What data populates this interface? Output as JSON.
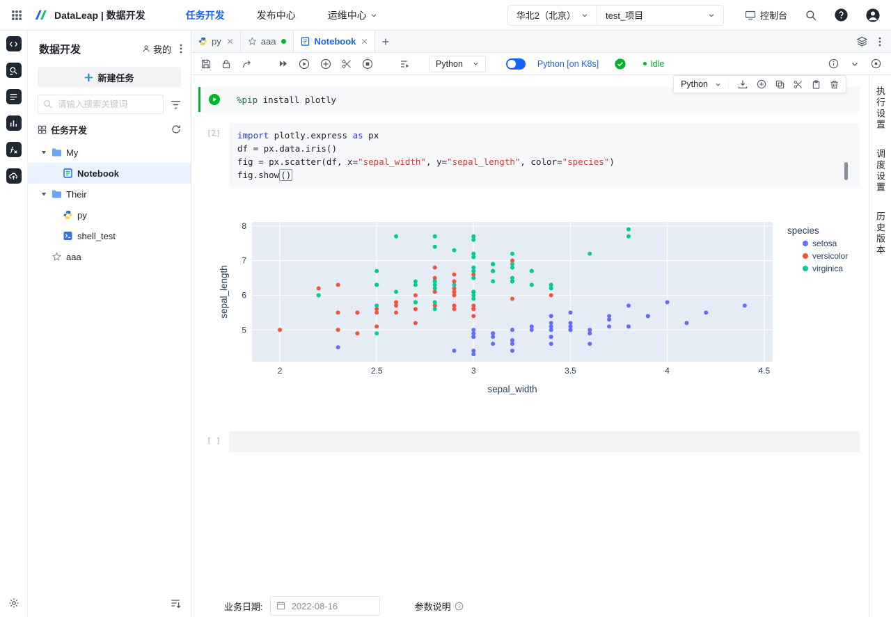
{
  "header": {
    "brand": "DataLeap | 数据开发",
    "nav": [
      {
        "label": "任务开发",
        "active": true,
        "caret": false
      },
      {
        "label": "发布中心",
        "active": false,
        "caret": false
      },
      {
        "label": "运维中心",
        "active": false,
        "caret": true
      }
    ],
    "region_select": "华北2（北京）",
    "project_select": "test_项目",
    "console_label": "控制台"
  },
  "sidebar": {
    "title": "数据开发",
    "mine_label": "我的",
    "new_task_label": "新建任务",
    "search_placeholder": "请输入搜索关键词",
    "section_label": "任务开发",
    "tree": [
      {
        "label": "My",
        "type": "folder",
        "depth": 0,
        "expanded": true,
        "selected": false
      },
      {
        "label": "Notebook",
        "type": "notebook",
        "depth": 1,
        "selected": true
      },
      {
        "label": "Their",
        "type": "folder",
        "depth": 0,
        "expanded": true,
        "selected": false
      },
      {
        "label": "py",
        "type": "python",
        "depth": 1,
        "selected": false
      },
      {
        "label": "shell_test",
        "type": "shell",
        "depth": 1,
        "selected": false
      },
      {
        "label": "aaa",
        "type": "star",
        "depth": 0,
        "selected": false
      }
    ]
  },
  "tabs": [
    {
      "label": "py",
      "icon": "python",
      "closable": true,
      "dot": false,
      "active": false
    },
    {
      "label": "aaa",
      "icon": "star",
      "closable": false,
      "dot": true,
      "active": false
    },
    {
      "label": "Notebook",
      "icon": "notebook",
      "closable": true,
      "dot": false,
      "active": true
    }
  ],
  "toolbar": {
    "kernel_select": "Python",
    "k8s_toggle_label": "Python [on K8s]",
    "status_label": "Idle"
  },
  "cell_toolbar": {
    "kernel_select": "Python"
  },
  "notebook": {
    "cells": [
      {
        "kind": "magic",
        "tokens": [
          [
            {
              "t": "magic",
              "s": "%pip"
            },
            {
              "t": "p",
              "s": " install plotly"
            }
          ]
        ]
      },
      {
        "kind": "code",
        "exec": "[2]",
        "output": "chart",
        "tokens": [
          [
            {
              "t": "kw",
              "s": "import"
            },
            {
              "t": "p",
              "s": " plotly.express "
            },
            {
              "t": "kw",
              "s": "as"
            },
            {
              "t": "p",
              "s": " px"
            }
          ],
          [
            {
              "t": "p",
              "s": "df = px.data.iris()"
            }
          ],
          [
            {
              "t": "p",
              "s": "fig = px.scatter(df, x="
            },
            {
              "t": "str",
              "s": "\"sepal_width\""
            },
            {
              "t": "p",
              "s": ", y="
            },
            {
              "t": "str",
              "s": "\"sepal_length\""
            },
            {
              "t": "p",
              "s": ", color="
            },
            {
              "t": "str",
              "s": "\"species\""
            },
            {
              "t": "p",
              "s": ")"
            }
          ],
          [
            {
              "t": "p",
              "s": "fig.show"
            },
            {
              "t": "box",
              "s": "()"
            }
          ]
        ]
      },
      {
        "kind": "empty",
        "exec": "[ ]"
      }
    ]
  },
  "right_panel": {
    "labels": [
      "执行设置",
      "调度设置",
      "历史版本"
    ]
  },
  "bottom_bar": {
    "date_label": "业务日期:",
    "date_value": "2022-08-16",
    "param_label": "参数说明"
  },
  "icons": {
    "help_glyph": "?",
    "accent_blue": "#1664ff",
    "success_green": "#00b42a"
  },
  "chart_data": {
    "type": "scatter",
    "title": "",
    "xlabel": "sepal_width",
    "ylabel": "sepal_length",
    "xlim": [
      1.856,
      4.544
    ],
    "ylim": [
      4.084,
      8.116
    ],
    "xticks": [
      2,
      2.5,
      3,
      3.5,
      4,
      4.5
    ],
    "yticks": [
      5,
      6,
      7,
      8
    ],
    "grid": true,
    "plot_bg": "#e5ecf6",
    "legend_title": "species",
    "legend_position": "right",
    "series": [
      {
        "name": "setosa",
        "color": "#636efa",
        "x": [
          3.5,
          3.0,
          3.2,
          3.1,
          3.6,
          3.9,
          3.4,
          3.4,
          2.9,
          3.1,
          3.7,
          3.4,
          3.0,
          3.0,
          4.0,
          4.4,
          3.9,
          3.5,
          3.8,
          3.8,
          3.4,
          3.7,
          3.6,
          3.3,
          3.4,
          3.0,
          3.4,
          3.5,
          3.4,
          3.2,
          3.1,
          3.4,
          4.1,
          4.2,
          3.1,
          3.2,
          3.5,
          3.6,
          3.0,
          3.4,
          3.5,
          2.3,
          3.2,
          3.5,
          3.8,
          3.0,
          3.8,
          3.2,
          3.7,
          3.3
        ],
        "y": [
          5.1,
          4.9,
          4.7,
          4.6,
          5.0,
          5.4,
          4.6,
          5.0,
          4.4,
          4.9,
          5.4,
          4.8,
          4.8,
          4.3,
          5.8,
          5.7,
          5.4,
          5.1,
          5.7,
          5.1,
          5.4,
          5.1,
          4.6,
          5.1,
          4.8,
          5.0,
          5.0,
          5.2,
          5.2,
          4.7,
          4.8,
          5.4,
          5.2,
          5.5,
          4.9,
          5.0,
          5.5,
          4.9,
          4.4,
          5.1,
          5.0,
          4.5,
          4.4,
          5.0,
          5.1,
          4.8,
          5.1,
          4.6,
          5.3,
          5.0
        ]
      },
      {
        "name": "versicolor",
        "color": "#EF553B",
        "x": [
          3.2,
          3.2,
          3.1,
          2.3,
          2.8,
          2.8,
          3.3,
          2.4,
          2.9,
          2.7,
          2.0,
          3.0,
          2.2,
          2.9,
          2.9,
          3.1,
          3.0,
          2.7,
          2.2,
          2.5,
          3.2,
          2.8,
          2.5,
          2.8,
          2.9,
          3.0,
          2.8,
          3.0,
          2.9,
          2.6,
          2.4,
          2.4,
          2.7,
          2.7,
          3.0,
          3.4,
          3.1,
          2.3,
          3.0,
          2.5,
          2.6,
          3.0,
          2.6,
          2.3,
          2.7,
          3.0,
          2.9,
          2.9,
          2.5,
          2.8
        ],
        "y": [
          7.0,
          6.4,
          6.9,
          5.5,
          6.5,
          5.7,
          6.3,
          4.9,
          6.6,
          5.2,
          5.0,
          5.9,
          6.0,
          6.1,
          5.6,
          6.7,
          5.6,
          5.8,
          6.2,
          5.6,
          5.9,
          6.1,
          6.3,
          6.1,
          6.4,
          6.6,
          6.8,
          6.7,
          6.0,
          5.7,
          5.5,
          5.5,
          5.8,
          6.0,
          5.4,
          6.0,
          6.7,
          6.3,
          5.6,
          5.5,
          5.5,
          6.1,
          5.8,
          5.0,
          5.6,
          5.7,
          5.7,
          6.2,
          5.1,
          5.7
        ]
      },
      {
        "name": "virginica",
        "color": "#00cc96",
        "x": [
          3.3,
          2.7,
          3.0,
          2.9,
          3.0,
          3.0,
          2.5,
          2.9,
          2.5,
          3.6,
          3.2,
          2.7,
          3.0,
          2.5,
          2.8,
          3.2,
          3.0,
          3.8,
          2.6,
          2.2,
          3.2,
          2.8,
          2.8,
          2.7,
          3.3,
          3.2,
          2.8,
          3.0,
          2.8,
          3.0,
          2.8,
          3.8,
          2.8,
          2.8,
          2.6,
          3.0,
          3.4,
          3.1,
          3.0,
          3.1,
          3.1,
          3.1,
          2.7,
          3.2,
          3.3,
          3.0,
          2.5,
          3.0,
          3.4,
          3.0
        ],
        "y": [
          6.3,
          5.8,
          7.1,
          6.3,
          6.5,
          7.6,
          4.9,
          7.3,
          6.7,
          7.2,
          6.5,
          6.4,
          6.8,
          5.7,
          5.8,
          6.4,
          6.5,
          7.7,
          7.7,
          6.0,
          6.9,
          5.6,
          7.7,
          6.3,
          6.7,
          7.2,
          6.2,
          6.1,
          6.4,
          7.2,
          7.4,
          7.9,
          6.4,
          6.3,
          6.1,
          7.7,
          6.3,
          6.4,
          6.0,
          6.9,
          6.7,
          6.9,
          5.8,
          6.8,
          6.7,
          6.7,
          6.3,
          6.5,
          6.2,
          5.9
        ]
      }
    ]
  }
}
